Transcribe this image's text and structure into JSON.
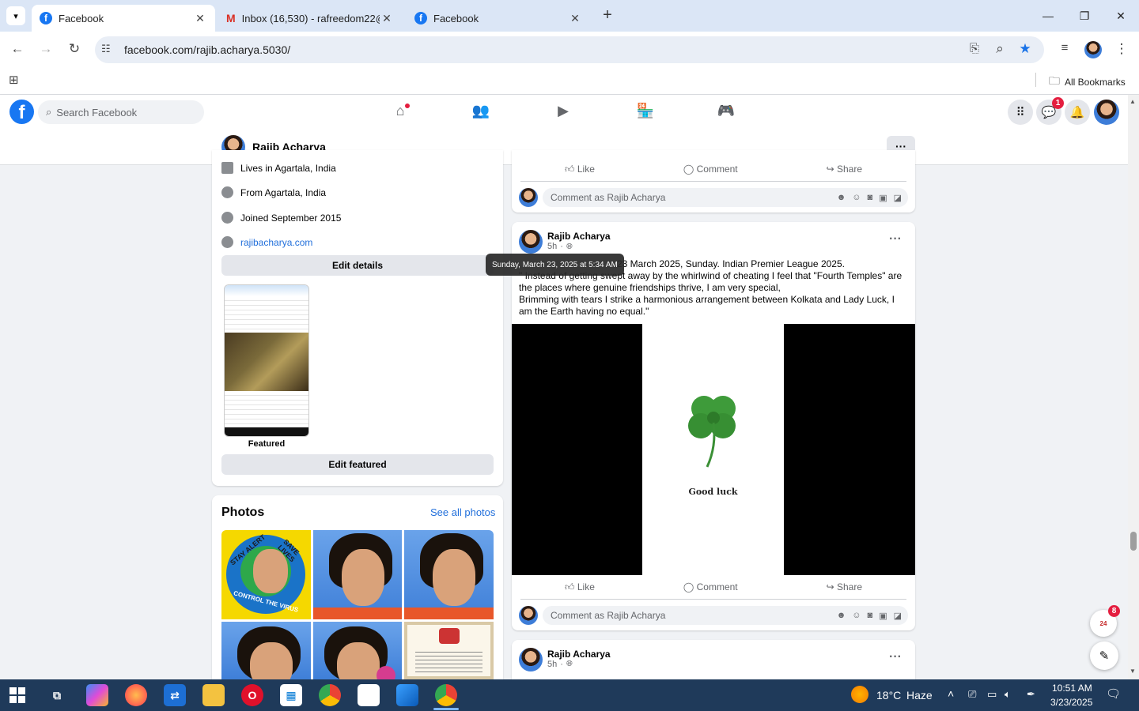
{
  "browser": {
    "tabs": [
      {
        "title": "Facebook",
        "active": true
      },
      {
        "title": "Inbox (16,530) - rafreedom22@",
        "active": false
      },
      {
        "title": "Facebook",
        "active": false
      }
    ],
    "new_tab": "+",
    "url": "facebook.com/rajib.acharya.5030/",
    "bookmarks_label": "All Bookmarks"
  },
  "fb": {
    "search_placeholder": "Search Facebook",
    "messenger_badge": "1",
    "notif_count": "8"
  },
  "profile": {
    "name": "Rajib Acharya",
    "more": "···"
  },
  "intro": {
    "lives": "Lives in Agartala, India",
    "from": "From Agartala, India",
    "joined": "Joined September 2015",
    "website": "rajibacharya.com",
    "edit_details": "Edit details",
    "featured_label": "Featured",
    "edit_featured": "Edit featured"
  },
  "photos": {
    "title": "Photos",
    "see_all": "See all photos",
    "stay_alert": "STAY ALERT",
    "save_lives": "SAVE LIVES",
    "control_virus": "CONTROL THE VIRUS"
  },
  "post_top": {
    "like": "Like",
    "comment": "Comment",
    "share": "Share",
    "comment_placeholder": "Comment as Rajib Acharya"
  },
  "post": {
    "author": "Rajib Acharya",
    "time": "5h",
    "tooltip": "Sunday, March 23, 2025 at 5:34 AM",
    "line1": "23 March 2025, Sunday.  Indian Premier League 2025.",
    "line2": "\" Instead of getting swept away by the whirlwind of cheating I feel that \"Fourth Temples\" are the places where genuine friendships thrive, I am very special,",
    "line3": "Brimming with tears I strike a harmonious arrangement between Kolkata and Lady Luck, I am the Earth having no equal.\"",
    "image_caption": "Good luck",
    "like": "Like",
    "comment": "Comment",
    "share": "Share",
    "comment_placeholder": "Comment as Rajib Acharya"
  },
  "post_next": {
    "author": "Rajib Acharya",
    "time": "5h"
  },
  "taskbar": {
    "temperature": "18°C",
    "weather": "Haze",
    "time": "10:51 AM",
    "date": "3/23/2025"
  }
}
